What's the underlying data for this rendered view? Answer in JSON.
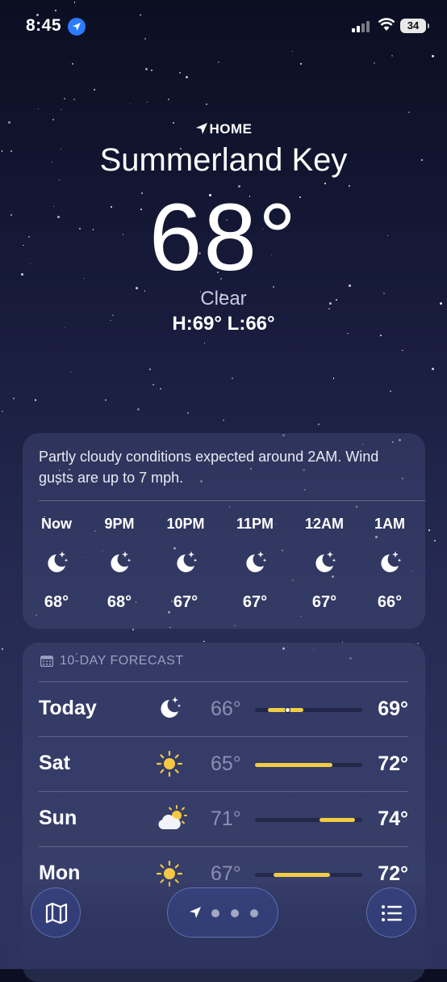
{
  "status_bar": {
    "time": "8:45",
    "battery": "34",
    "location_services": "location-arrow-icon"
  },
  "header": {
    "location_label": "HOME",
    "city": "Summerland Key",
    "temperature": "68°",
    "condition": "Clear",
    "high_low": "H:69°  L:66°"
  },
  "hourly": {
    "summary": "Partly cloudy conditions expected around 2AM. Wind gusts are up to 7 mph.",
    "hours": [
      {
        "label": "Now",
        "icon": "moon-stars-icon",
        "temp": "68°"
      },
      {
        "label": "9PM",
        "icon": "moon-stars-icon",
        "temp": "68°"
      },
      {
        "label": "10PM",
        "icon": "moon-stars-icon",
        "temp": "67°"
      },
      {
        "label": "11PM",
        "icon": "moon-stars-icon",
        "temp": "67°"
      },
      {
        "label": "12AM",
        "icon": "moon-stars-icon",
        "temp": "67°"
      },
      {
        "label": "1AM",
        "icon": "moon-stars-icon",
        "temp": "66°"
      }
    ]
  },
  "forecast": {
    "title": "10-DAY FORECAST",
    "days": [
      {
        "day": "Today",
        "icon": "moon-stars-icon",
        "low": "66°",
        "high": "69°",
        "range_start": 0.12,
        "range_end": 0.45,
        "current_pos": 0.3
      },
      {
        "day": "Sat",
        "icon": "sun-icon",
        "low": "65°",
        "high": "72°",
        "range_start": 0.0,
        "range_end": 0.72
      },
      {
        "day": "Sun",
        "icon": "partly-cloudy-icon",
        "low": "71°",
        "high": "74°",
        "range_start": 0.6,
        "range_end": 0.93
      },
      {
        "day": "Mon",
        "icon": "sun-icon",
        "low": "67°",
        "high": "72°",
        "range_start": 0.17,
        "range_end": 0.7
      }
    ]
  },
  "toolbar": {
    "map_button": "map-icon",
    "list_button": "list-icon",
    "page_count": 3
  },
  "colors": {
    "range_bar": "#f0cd45",
    "sun": "#f5c842",
    "location_pill": "#2b7cff"
  }
}
